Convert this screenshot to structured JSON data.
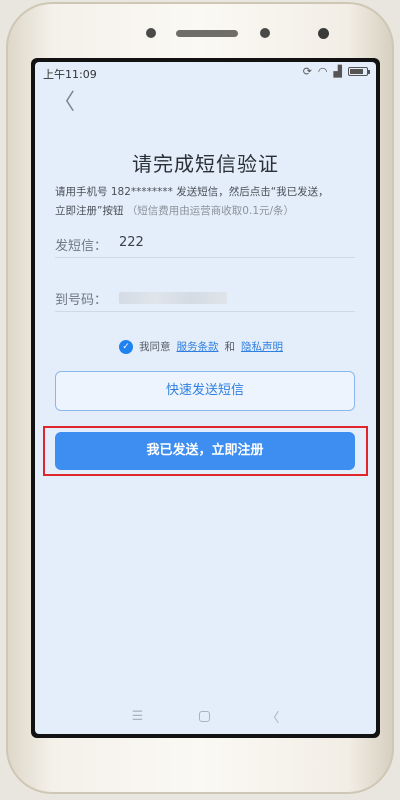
{
  "status_bar": {
    "time": "上午11:09"
  },
  "header": {
    "back_glyph": "〈",
    "title": "请完成短信验证"
  },
  "instruction": {
    "line1": "请用手机号 182******** 发送短信，然后点击“我已发送，",
    "line2_main": "立即注册”按钮",
    "line2_fee": "（短信费用由运营商收取0.1元/条）"
  },
  "sms_row": {
    "label": "发短信：",
    "value": "222"
  },
  "number_row": {
    "label": "到号码："
  },
  "agreement": {
    "prefix": "我同意",
    "terms_link": "服务条款",
    "and": "和",
    "privacy_link": "隐私声明"
  },
  "buttons": {
    "quick_send": "快速发送短信",
    "confirm_register": "我已发送，立即注册"
  },
  "nav": {
    "menu": "☰",
    "back": "〈"
  },
  "colors": {
    "accent": "#3e8df0",
    "highlight": "#e0252b",
    "screen_bg": "#e4eefa"
  }
}
